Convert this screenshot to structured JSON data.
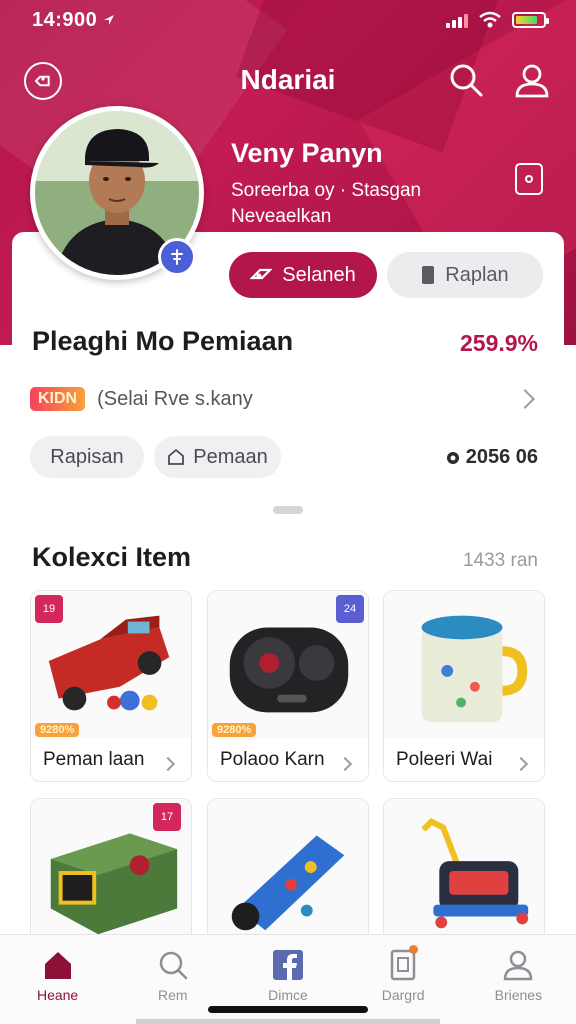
{
  "status_bar": {
    "time": "14:900"
  },
  "nav": {
    "title": "Ndariai"
  },
  "profile": {
    "name": "Veny Panyn",
    "subtitle_line1": "Soreerba oy · Stasgan",
    "subtitle_line2": "Neveaelkan"
  },
  "actions": {
    "primary_label": "Selaneh",
    "secondary_label": "Raplan"
  },
  "summary": {
    "title": "Pleaghi Mo Pemiaan",
    "price": "259.9%",
    "badge": "KIDN",
    "info_text": "(Selai Rve s.kany",
    "chip1_label": "Rapisan",
    "chip2_label": "Pemaan",
    "stat_value": "2056 06"
  },
  "collection": {
    "title": "Kolexci Item",
    "count": "1433 ran",
    "items": [
      {
        "label": "Peman laan",
        "tag": "9280%",
        "corner": "19"
      },
      {
        "label": "Polaoo Karn",
        "tag": "9280%",
        "corner": "24"
      },
      {
        "label": "Poleeri Wai"
      },
      {
        "label": "",
        "corner": "17"
      },
      {
        "label": ""
      },
      {
        "label": ""
      }
    ]
  },
  "tabbar": {
    "tabs": [
      {
        "label": "Heane"
      },
      {
        "label": "Rem"
      },
      {
        "label": "Dimce"
      },
      {
        "label": "Dargrd"
      },
      {
        "label": "Brienes"
      }
    ]
  },
  "colors": {
    "brand": "#b3174a",
    "accent_blue": "#4a5fd9",
    "tab_active": "#8b1236"
  }
}
